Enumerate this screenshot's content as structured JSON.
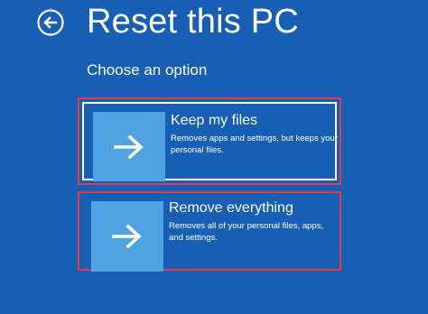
{
  "header": {
    "title": "Reset this PC",
    "back_icon": "back-arrow-icon"
  },
  "subtitle": "Choose an option",
  "options": [
    {
      "title": "Keep my files",
      "description": "Removes apps and settings, but keeps your personal files.",
      "icon": "arrow-right-icon",
      "selected": true
    },
    {
      "title": "Remove everything",
      "description": "Removes all of your personal files, apps, and settings.",
      "icon": "arrow-right-icon",
      "selected": false
    }
  ],
  "colors": {
    "background": "#165fb5",
    "tile": "#4ea3e0",
    "highlight_border": "#e03c4a",
    "focus_border": "#ffffff"
  }
}
